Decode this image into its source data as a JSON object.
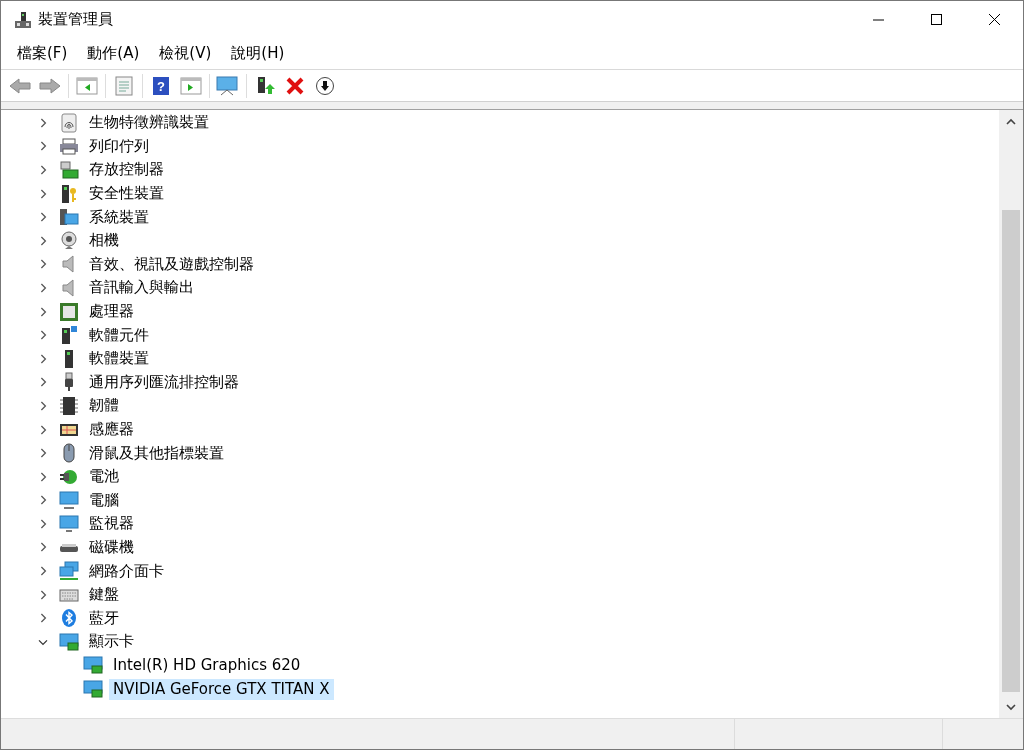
{
  "window": {
    "title": "裝置管理員"
  },
  "menu": [
    "檔案(F)",
    "動作(A)",
    "檢視(V)",
    "說明(H)"
  ],
  "toolbar": {
    "help_glyph": "?"
  },
  "tree": [
    {
      "label": "生物特徵辨識裝置",
      "expanded": false,
      "selected": false
    },
    {
      "label": "列印佇列",
      "expanded": false,
      "selected": false
    },
    {
      "label": "存放控制器",
      "expanded": false,
      "selected": false
    },
    {
      "label": "安全性裝置",
      "expanded": false,
      "selected": false
    },
    {
      "label": "系統裝置",
      "expanded": false,
      "selected": false
    },
    {
      "label": "相機",
      "expanded": false,
      "selected": false
    },
    {
      "label": "音效、視訊及遊戲控制器",
      "expanded": false,
      "selected": false
    },
    {
      "label": "音訊輸入與輸出",
      "expanded": false,
      "selected": false
    },
    {
      "label": "處理器",
      "expanded": false,
      "selected": false
    },
    {
      "label": "軟體元件",
      "expanded": false,
      "selected": false
    },
    {
      "label": "軟體裝置",
      "expanded": false,
      "selected": false
    },
    {
      "label": "通用序列匯流排控制器",
      "expanded": false,
      "selected": false
    },
    {
      "label": "韌體",
      "expanded": false,
      "selected": false
    },
    {
      "label": "感應器",
      "expanded": false,
      "selected": false
    },
    {
      "label": "滑鼠及其他指標裝置",
      "expanded": false,
      "selected": false
    },
    {
      "label": "電池",
      "expanded": false,
      "selected": false
    },
    {
      "label": "電腦",
      "expanded": false,
      "selected": false
    },
    {
      "label": "監視器",
      "expanded": false,
      "selected": false
    },
    {
      "label": "磁碟機",
      "expanded": false,
      "selected": false
    },
    {
      "label": "網路介面卡",
      "expanded": false,
      "selected": false
    },
    {
      "label": "鍵盤",
      "expanded": false,
      "selected": false
    },
    {
      "label": "藍牙",
      "expanded": false,
      "selected": false
    },
    {
      "label": "顯示卡",
      "expanded": true,
      "selected": false,
      "children": [
        {
          "label": "Intel(R) HD Graphics 620",
          "selected": false
        },
        {
          "label": "NVIDIA GeForce GTX TITAN X",
          "selected": true
        }
      ]
    }
  ]
}
